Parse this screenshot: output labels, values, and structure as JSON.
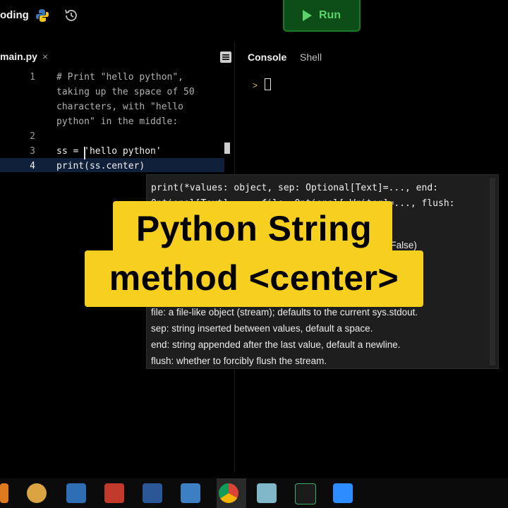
{
  "header": {
    "app_name": "oding",
    "run_label": "Run"
  },
  "editor": {
    "file_tab": "main.py",
    "close_glyph": "×",
    "lines": [
      {
        "num": "1",
        "text": "# Print \"hello python\","
      },
      {
        "num": "",
        "text": "taking up the space of 50"
      },
      {
        "num": "",
        "text": "characters, with \"hello"
      },
      {
        "num": "",
        "text": "python\" in the middle:"
      },
      {
        "num": "2",
        "text": ""
      },
      {
        "num": "3",
        "text": "ss = 'hello python'"
      },
      {
        "num": "4",
        "text": "print(ss.center)"
      }
    ]
  },
  "console": {
    "tabs": [
      "Console",
      "Shell"
    ],
    "prompt": ">"
  },
  "tooltip": {
    "signature_line1": "print(*values: object, sep: Optional[Text]=..., end:",
    "signature_line2": "Optional[Text]=..., file: Optional[_Writer]=..., flush:",
    "flush_default": "h=False)",
    "params": [
      "file:  a file-like object (stream); defaults to the current sys.stdout.",
      "sep:   string inserted between values, default a space.",
      "end:   string appended after the last value, default a newline.",
      "flush: whether to forcibly flush the stream."
    ]
  },
  "banner": {
    "line1": "Python String",
    "line2": "method <center>"
  },
  "colors": {
    "accent_run": "#5ad46a",
    "banner": "#f6cf1f"
  }
}
